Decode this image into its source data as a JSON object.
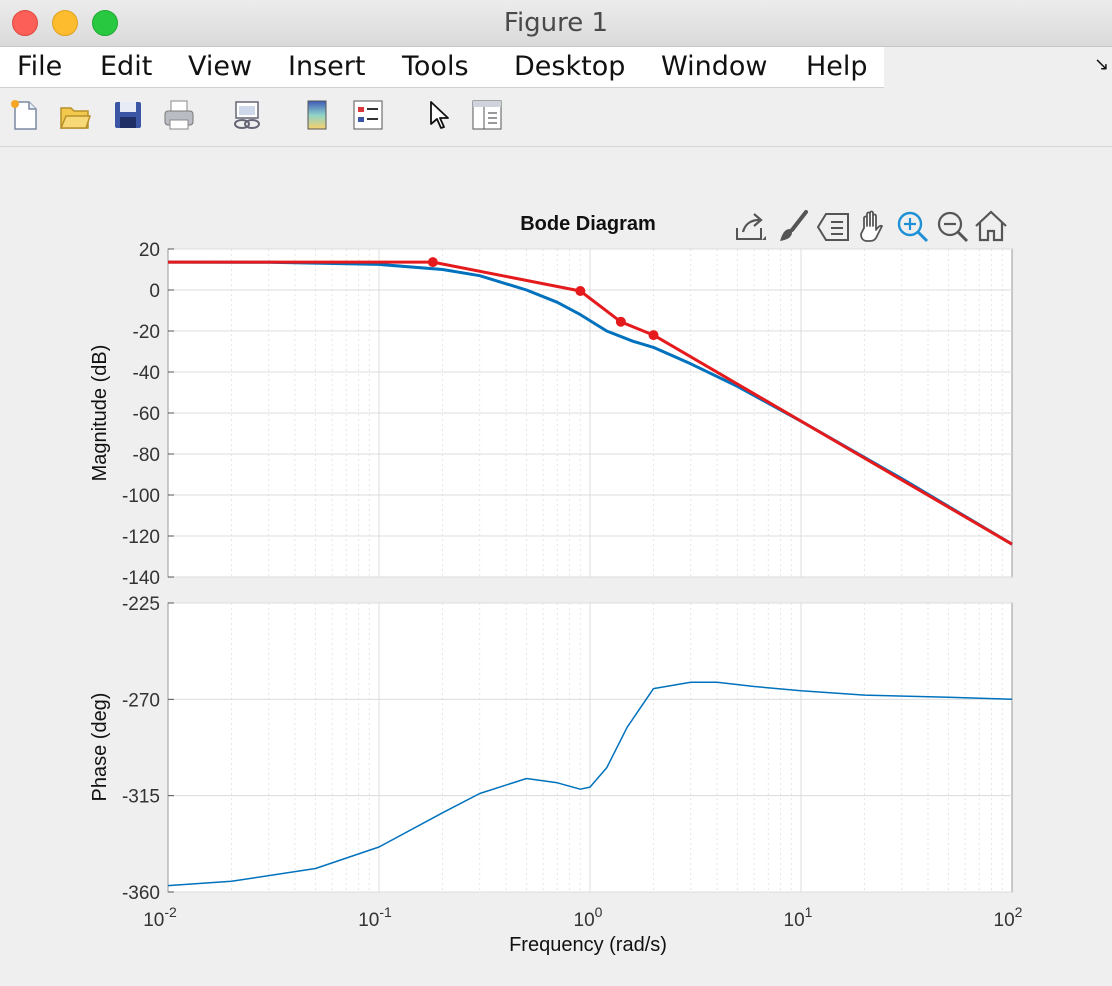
{
  "window": {
    "title": "Figure 1"
  },
  "menu": {
    "items": [
      "File",
      "Edit",
      "View",
      "Insert",
      "Tools",
      "Desktop",
      "Window",
      "Help"
    ]
  },
  "toolbar": {
    "icons": [
      "new-figure-icon",
      "open-file-icon",
      "save-icon",
      "print-icon",
      "link-plot-icon",
      "colorbar-icon",
      "legend-icon",
      "select-pointer-icon",
      "property-inspector-icon"
    ]
  },
  "axes_toolbar": {
    "icons": [
      "export-icon",
      "brush-icon",
      "data-tips-icon",
      "pan-icon",
      "zoom-in-icon",
      "zoom-out-icon",
      "restore-view-icon"
    ]
  },
  "chart_data": [
    {
      "type": "line",
      "title": "Bode Diagram",
      "xlabel": "",
      "ylabel": "Magnitude (dB)",
      "xscale": "log",
      "xlim": [
        0.01,
        100
      ],
      "ylim": [
        -140,
        20
      ],
      "yticks": [
        "20",
        "0",
        "-20",
        "-40",
        "-60",
        "-80",
        "-100",
        "-120",
        "-140"
      ],
      "grid": true,
      "series": [
        {
          "color": "#0072bd",
          "x": [
            0.01,
            0.03,
            0.1,
            0.2,
            0.3,
            0.5,
            0.7,
            0.9,
            1.2,
            1.6,
            2,
            3,
            5,
            10,
            30,
            100
          ],
          "y": [
            13.6,
            13.5,
            12.5,
            10,
            7,
            0,
            -6,
            -12,
            -20,
            -25,
            -28,
            -36,
            -47,
            -64,
            -92,
            -124
          ]
        },
        {
          "color": "#e41a1c",
          "x": [
            0.01,
            0.18,
            0.9,
            1.4,
            2.0,
            100
          ],
          "y": [
            13.6,
            13.6,
            -0.5,
            -15.5,
            -22,
            -124
          ],
          "markers": [
            0.18,
            0.9,
            1.4,
            2.0
          ]
        }
      ]
    },
    {
      "type": "line",
      "xlabel": "Frequency  (rad/s)",
      "ylabel": "Phase (deg)",
      "xscale": "log",
      "xlim": [
        0.01,
        100
      ],
      "ylim": [
        -360,
        -225
      ],
      "yticks": [
        "-225",
        "-270",
        "-315",
        "-360"
      ],
      "xticks": [
        "10",
        "10",
        "10",
        "10",
        "10"
      ],
      "xtick_exponents": [
        "-2",
        "-1",
        "0",
        "1",
        "2"
      ],
      "grid": true,
      "series": [
        {
          "color": "#0072bd",
          "x": [
            0.01,
            0.02,
            0.05,
            0.1,
            0.2,
            0.3,
            0.5,
            0.7,
            0.9,
            1.0,
            1.2,
            1.5,
            2,
            3,
            4,
            6,
            10,
            20,
            50,
            100
          ],
          "y": [
            -357,
            -355,
            -349,
            -339,
            -323,
            -314,
            -307,
            -309,
            -312,
            -311,
            -302,
            -283,
            -265,
            -262,
            -262,
            -264,
            -266,
            -268,
            -269,
            -270
          ]
        }
      ]
    }
  ]
}
